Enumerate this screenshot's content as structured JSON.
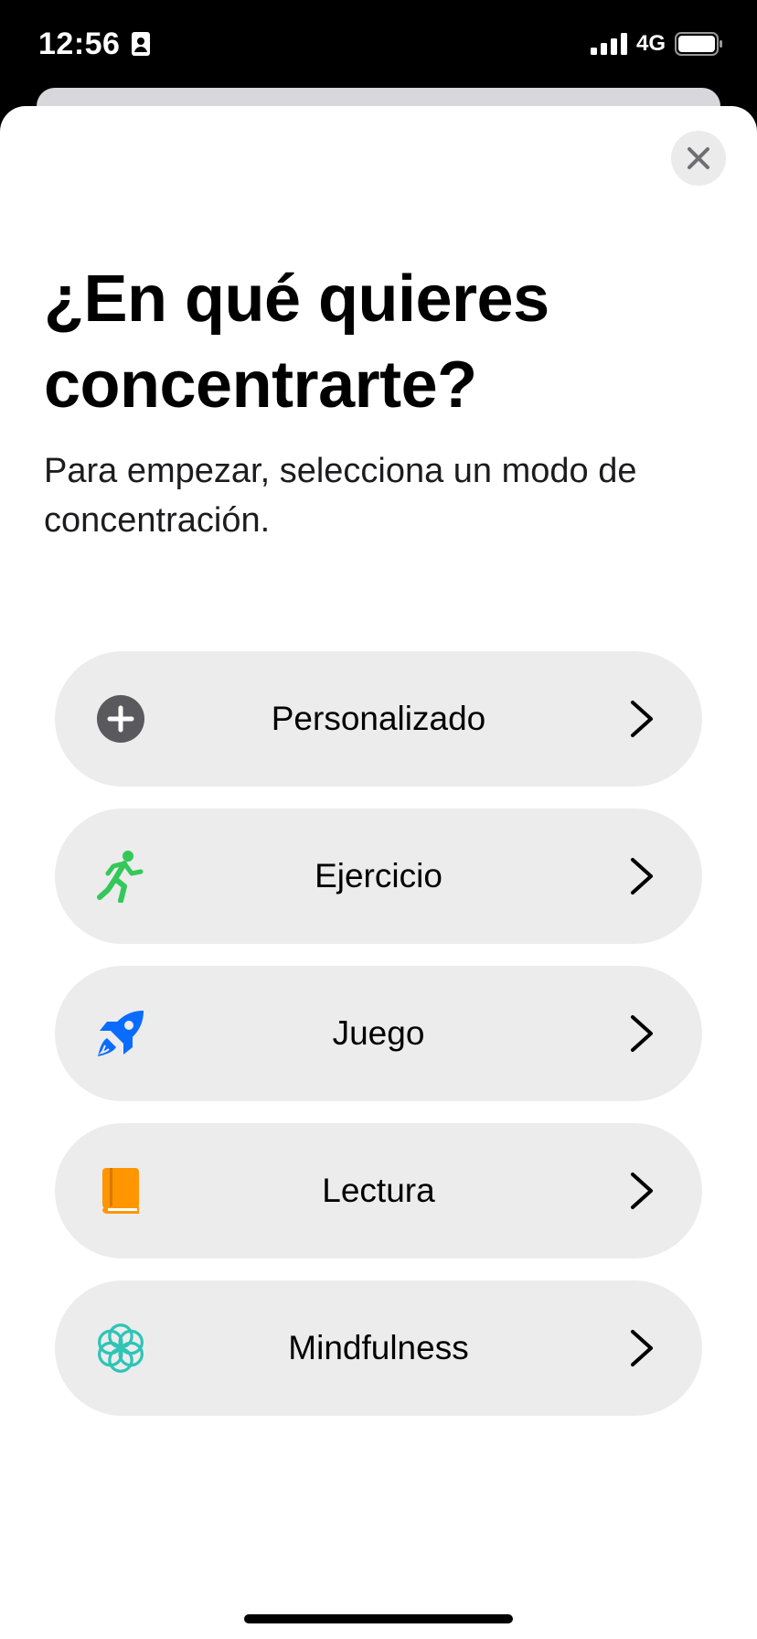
{
  "status_bar": {
    "time": "12:56",
    "network": "4G"
  },
  "sheet": {
    "title": "¿En qué quieres concentrarte?",
    "subtitle": "Para empezar, selecciona un modo de concentración."
  },
  "options": [
    {
      "label": "Personalizado",
      "icon": "plus-circle-icon",
      "color": "#5a5a5e"
    },
    {
      "label": "Ejercicio",
      "icon": "running-figure-icon",
      "color": "#34c759"
    },
    {
      "label": "Juego",
      "icon": "rocket-icon",
      "color": "#0a6cff"
    },
    {
      "label": "Lectura",
      "icon": "book-icon",
      "color": "#ff9500"
    },
    {
      "label": "Mindfulness",
      "icon": "flower-icon",
      "color": "#2ec4b6"
    }
  ]
}
